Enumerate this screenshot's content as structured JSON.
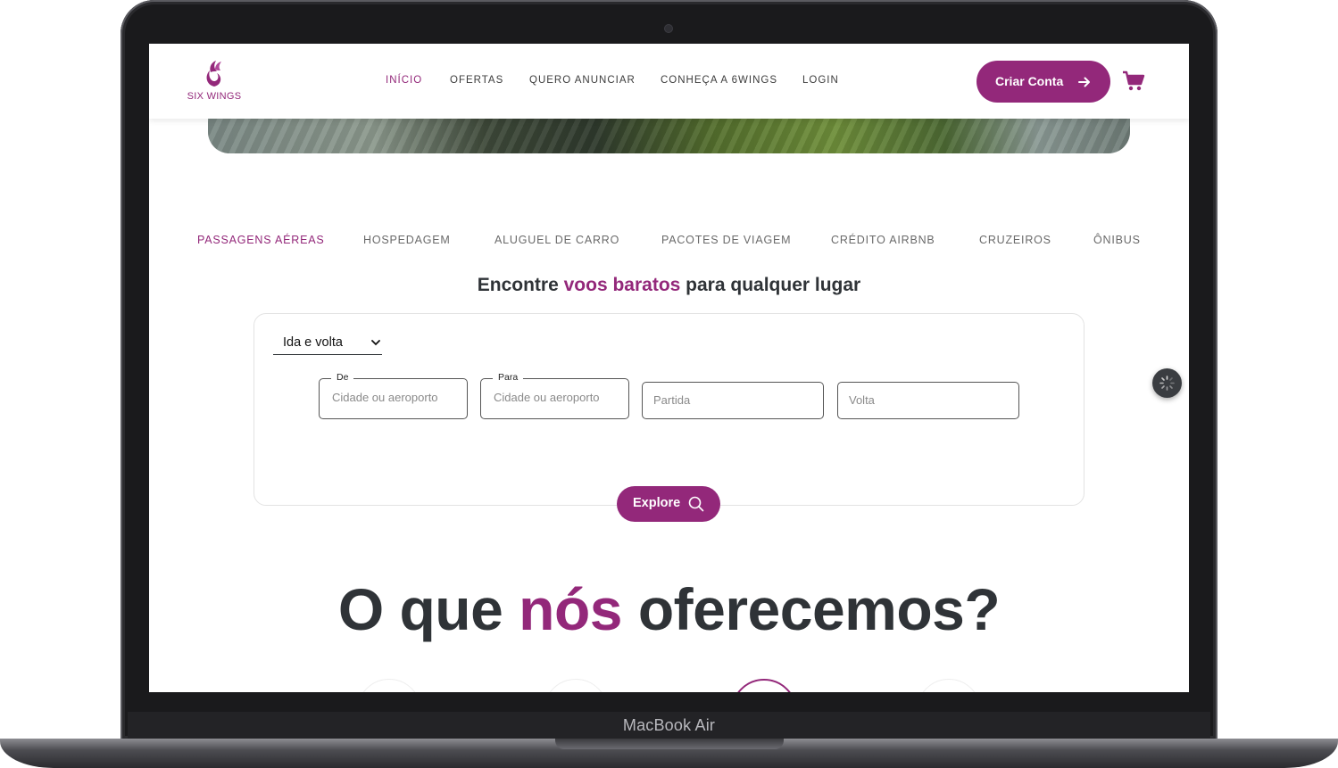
{
  "device": {
    "label": "MacBook Air"
  },
  "brand": {
    "name": "SIX WINGS",
    "color": "#93287a",
    "text_color": "#2f3337"
  },
  "nav": {
    "items": [
      {
        "label": "INÍCIO",
        "active": true
      },
      {
        "label": "OFERTAS",
        "active": false
      },
      {
        "label": "QUERO ANUNCIAR",
        "active": false
      },
      {
        "label": "CONHEÇA A 6WINGS",
        "active": false
      },
      {
        "label": "LOGIN",
        "active": false
      }
    ],
    "cta_label": "Criar Conta",
    "cta_icon": "arrow-right-icon",
    "cart_icon": "shopping-cart-icon"
  },
  "tabs": [
    {
      "label": "PASSAGENS AÉREAS",
      "active": true
    },
    {
      "label": "HOSPEDAGEM",
      "active": false
    },
    {
      "label": "ALUGUEL DE CARRO",
      "active": false
    },
    {
      "label": "PACOTES DE VIAGEM",
      "active": false
    },
    {
      "label": "CRÉDITO AIRBNB",
      "active": false
    },
    {
      "label": "CRUZEIROS",
      "active": false
    },
    {
      "label": "ÔNIBUS",
      "active": false
    }
  ],
  "search": {
    "headline": {
      "pre": "Encontre ",
      "accent": "voos baratos",
      "post": " para qualquer lugar"
    },
    "trip_type": "Ida e volta",
    "from": {
      "legend": "De",
      "placeholder": "Cidade ou aeroporto"
    },
    "to": {
      "legend": "Para",
      "placeholder": "Cidade ou aeroporto"
    },
    "departure": {
      "placeholder": "Partida"
    },
    "return": {
      "placeholder": "Volta"
    },
    "button_label": "Explore",
    "button_icon": "search-icon"
  },
  "offer_section": {
    "pre": "O que ",
    "accent": "nós",
    "post": " oferecemos?"
  }
}
